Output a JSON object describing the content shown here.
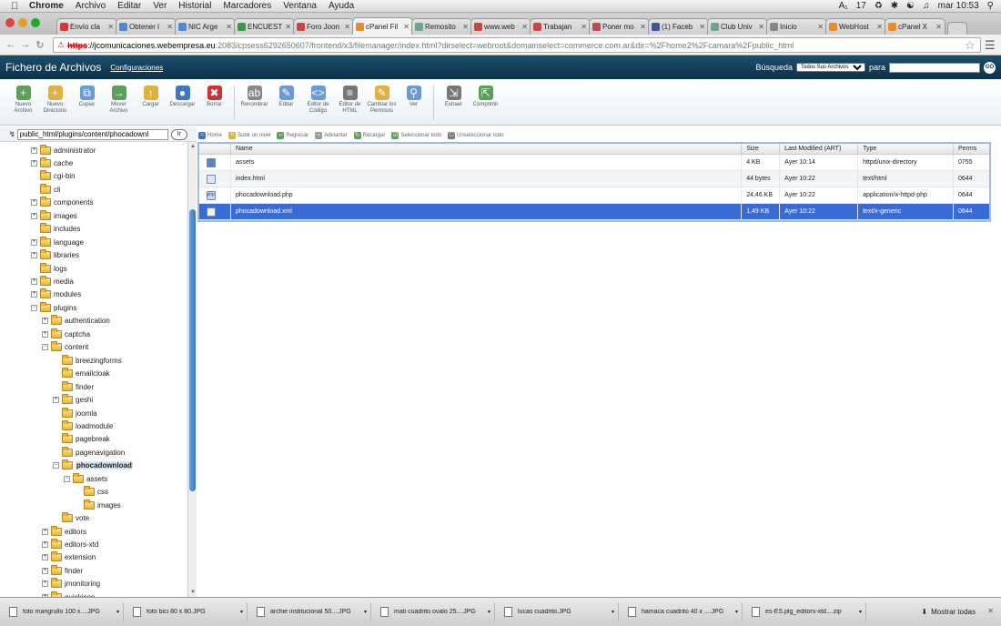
{
  "menubar": {
    "items": [
      "Chrome",
      "Archivo",
      "Editar",
      "Ver",
      "Historial",
      "Marcadores",
      "Ventana",
      "Ayuda"
    ],
    "status": {
      "adobe": "17",
      "time": "mar 10:53"
    }
  },
  "tabs": [
    {
      "label": "Envío cla",
      "color": "#d33"
    },
    {
      "label": "Obtener l",
      "color": "#4a8ad8"
    },
    {
      "label": "NIC Arge",
      "color": "#4a8ad8"
    },
    {
      "label": "ENCUEST",
      "color": "#3a9a3a"
    },
    {
      "label": "Foro Joon",
      "color": "#c44"
    },
    {
      "label": "cPanel Fil",
      "color": "#f08a1c",
      "active": true
    },
    {
      "label": "Remosito",
      "color": "#6a8"
    },
    {
      "label": "www.web",
      "color": "#c44"
    },
    {
      "label": "Trabajan",
      "color": "#c44"
    },
    {
      "label": "Poner mo",
      "color": "#c44"
    },
    {
      "label": "(1) Faceb",
      "color": "#3b5998"
    },
    {
      "label": "Club Univ",
      "color": "#6a8"
    },
    {
      "label": "Inicio",
      "color": "#888"
    },
    {
      "label": "WebHost",
      "color": "#f08a1c"
    },
    {
      "label": "cPanel X",
      "color": "#f08a1c"
    }
  ],
  "address": {
    "https": "https",
    "host": "://jcomunicaciones.webempresa.eu",
    "path": ":2083/cpsess6292650607/frontend/x3/filemanager/index.html?dirselect=webroot&domainselect=commerce.com.ar&dir=%2Fhome2%2Fcamara%2Fpublic_html"
  },
  "header": {
    "title": "Fichero de Archivos",
    "config": "Configuraciones",
    "search_label": "Búsqueda",
    "search_scope": "Todos Sus Archivos",
    "for_label": "para",
    "go": "GO"
  },
  "toolbar": [
    {
      "label": "Nuevo Archivo",
      "icon": "new-file-icon",
      "color": "#5aa05a"
    },
    {
      "label": "Nuevo Directorio",
      "icon": "new-folder-icon",
      "color": "#e0b040"
    },
    {
      "label": "Copiar",
      "icon": "copy-icon",
      "color": "#6a9ad8"
    },
    {
      "label": "Mover Archivo",
      "icon": "move-icon",
      "color": "#5aa05a"
    },
    {
      "label": "Cargar",
      "icon": "upload-icon",
      "color": "#e0b040"
    },
    {
      "label": "Descargar",
      "icon": "download-icon",
      "color": "#3a7ac0"
    },
    {
      "label": "Borrar",
      "icon": "delete-icon",
      "color": "#d03030"
    },
    {
      "label": "Renombrar",
      "icon": "rename-icon",
      "color": "#888"
    },
    {
      "label": "Editar",
      "icon": "edit-icon",
      "color": "#6a9ad8"
    },
    {
      "label": "Editor de Código",
      "icon": "code-editor-icon",
      "color": "#6a9ad8"
    },
    {
      "label": "Editor de HTML",
      "icon": "html-editor-icon",
      "color": "#777"
    },
    {
      "label": "Cambiar los Permisos",
      "icon": "permissions-icon",
      "color": "#e0b040"
    },
    {
      "label": "Ver",
      "icon": "view-icon",
      "color": "#6a9ad8"
    },
    {
      "label": "Extraer",
      "icon": "extract-icon",
      "color": "#777"
    },
    {
      "label": "Comprimir",
      "icon": "compress-icon",
      "color": "#5aa05a"
    }
  ],
  "pathbar": {
    "value": "public_html/plugins/content/phocadownl",
    "go": "Ir"
  },
  "tree": [
    {
      "label": "administrator",
      "depth": 0,
      "exp": "+"
    },
    {
      "label": "cache",
      "depth": 0,
      "exp": "+"
    },
    {
      "label": "cgi-bin",
      "depth": 0,
      "exp": ""
    },
    {
      "label": "cli",
      "depth": 0,
      "exp": ""
    },
    {
      "label": "components",
      "depth": 0,
      "exp": "+"
    },
    {
      "label": "images",
      "depth": 0,
      "exp": "+"
    },
    {
      "label": "includes",
      "depth": 0,
      "exp": ""
    },
    {
      "label": "language",
      "depth": 0,
      "exp": "+"
    },
    {
      "label": "libraries",
      "depth": 0,
      "exp": "+"
    },
    {
      "label": "logs",
      "depth": 0,
      "exp": ""
    },
    {
      "label": "media",
      "depth": 0,
      "exp": "+"
    },
    {
      "label": "modules",
      "depth": 0,
      "exp": "+"
    },
    {
      "label": "plugins",
      "depth": 0,
      "exp": "-"
    },
    {
      "label": "authentication",
      "depth": 1,
      "exp": "+"
    },
    {
      "label": "captcha",
      "depth": 1,
      "exp": "+"
    },
    {
      "label": "content",
      "depth": 1,
      "exp": "-"
    },
    {
      "label": "breezingforms",
      "depth": 2,
      "exp": ""
    },
    {
      "label": "emailcloak",
      "depth": 2,
      "exp": ""
    },
    {
      "label": "finder",
      "depth": 2,
      "exp": ""
    },
    {
      "label": "geshi",
      "depth": 2,
      "exp": "+"
    },
    {
      "label": "joomla",
      "depth": 2,
      "exp": ""
    },
    {
      "label": "loadmodule",
      "depth": 2,
      "exp": ""
    },
    {
      "label": "pagebreak",
      "depth": 2,
      "exp": ""
    },
    {
      "label": "pagenavigation",
      "depth": 2,
      "exp": ""
    },
    {
      "label": "phocadownload",
      "depth": 2,
      "exp": "-",
      "selected": true
    },
    {
      "label": "assets",
      "depth": 3,
      "exp": "-"
    },
    {
      "label": "css",
      "depth": 4,
      "exp": ""
    },
    {
      "label": "images",
      "depth": 4,
      "exp": ""
    },
    {
      "label": "vote",
      "depth": 2,
      "exp": ""
    },
    {
      "label": "editors",
      "depth": 1,
      "exp": "+"
    },
    {
      "label": "editors-xtd",
      "depth": 1,
      "exp": "+"
    },
    {
      "label": "extension",
      "depth": 1,
      "exp": "+"
    },
    {
      "label": "finder",
      "depth": 1,
      "exp": "+"
    },
    {
      "label": "jmonitoring",
      "depth": 1,
      "exp": "+"
    },
    {
      "label": "quickicon",
      "depth": 1,
      "exp": "+"
    }
  ],
  "actions": [
    {
      "label": "Home",
      "color": "#3a7ac0"
    },
    {
      "label": "Subir un nivel",
      "color": "#e0b040"
    },
    {
      "label": "Regresar",
      "color": "#5aa05a"
    },
    {
      "label": "Adelantar",
      "color": "#9a9a9a"
    },
    {
      "label": "Recargar",
      "color": "#5aa05a"
    },
    {
      "label": "Seleccionar todo",
      "color": "#5aa05a"
    },
    {
      "label": "Unseleccionar todo",
      "color": "#777"
    }
  ],
  "table": {
    "headers": [
      "",
      "Name",
      "Size",
      "Last Modified (ART)",
      "Type",
      "Perms"
    ],
    "rows": [
      {
        "icon": "dir",
        "name": "assets",
        "size": "4 KB",
        "modified": "Ayer 10:14",
        "type": "httpd/unix-directory",
        "perms": "0755"
      },
      {
        "icon": "html",
        "name": "index.html",
        "size": "44 bytes",
        "modified": "Ayer 10:22",
        "type": "text/html",
        "perms": "0644"
      },
      {
        "icon": "php",
        "name": "phocadownload.php",
        "size": "24,46 KB",
        "modified": "Ayer 10:22",
        "type": "application/x-httpd-php",
        "perms": "0644"
      },
      {
        "icon": "xml",
        "name": "phocadownload.xml",
        "size": "1,49 KB",
        "modified": "Ayer 10:22",
        "type": "text/x-generic",
        "perms": "0644",
        "selected": true
      }
    ]
  },
  "downloads": [
    {
      "name": "foto mangrullo 100  x....JPG"
    },
    {
      "name": "foto bici 80  x 80.JPG"
    },
    {
      "name": "archie institucional 50....JPG"
    },
    {
      "name": "mati cuadrito ovalo 25....JPG"
    },
    {
      "name": "lucas cuadrito.JPG"
    },
    {
      "name": "hamaca cuadrito 40 x ....JPG"
    },
    {
      "name": "es-ES.plg_editors-xtd....zip"
    }
  ],
  "downloads_show_all": "Mostrar todas"
}
